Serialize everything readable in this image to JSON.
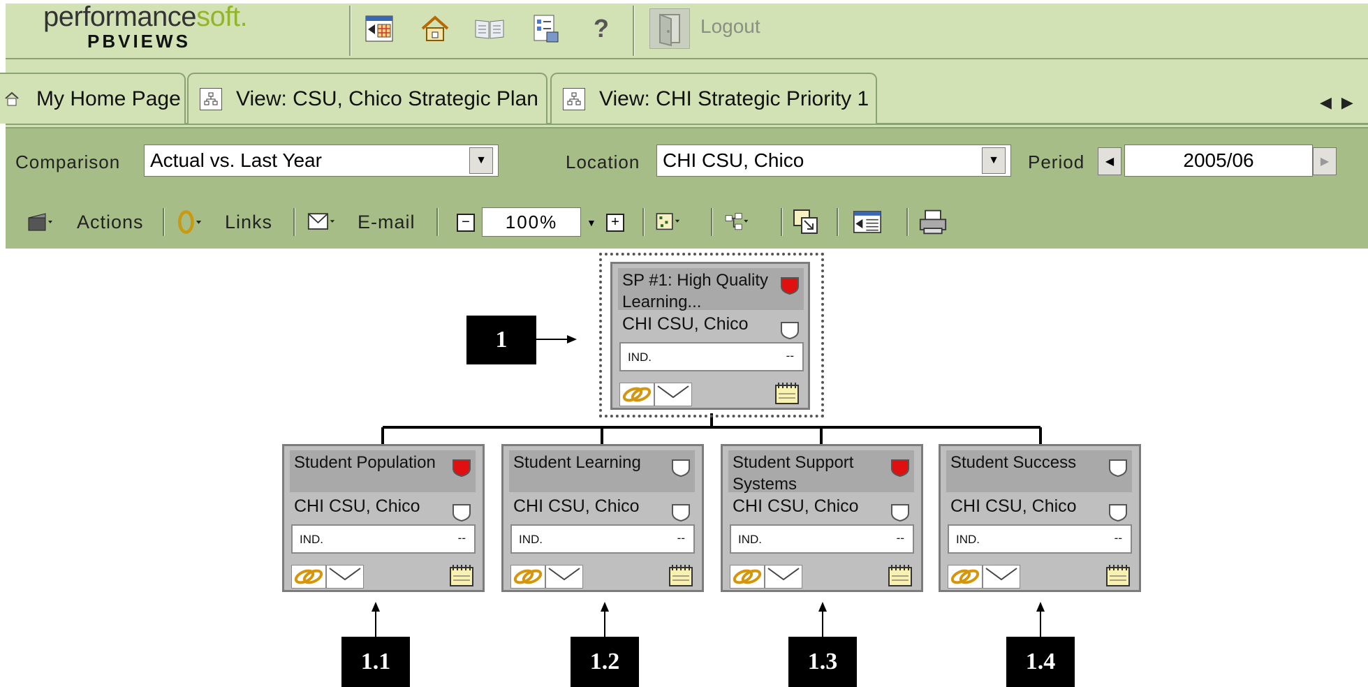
{
  "app": {
    "logo_main": "performance",
    "logo_accent": "soft.",
    "logo_sub": "PBVIEWS",
    "logout_label": "Logout",
    "help_label": "?"
  },
  "tabs": [
    {
      "label": "My Home Page",
      "icon": "home-icon"
    },
    {
      "label": "View: CSU, Chico Strategic Plan",
      "icon": "hierarchy-icon"
    },
    {
      "label": "View: CHI Strategic Priority 1",
      "icon": "hierarchy-icon"
    }
  ],
  "filters": {
    "comparison_label": "Comparison",
    "comparison_value": "Actual vs. Last Year",
    "location_label": "Location",
    "location_value": "CHI CSU, Chico",
    "period_label": "Period",
    "period_value": "2005/06"
  },
  "toolbar": {
    "actions_label": "Actions",
    "links_label": "Links",
    "email_label": "E-mail",
    "zoom_value": "100%"
  },
  "cards": [
    {
      "id": "1",
      "title": "SP #1: High Quality Learning...",
      "location": "CHI CSU, Chico",
      "indicator": "IND.",
      "value": "--",
      "status": "red"
    },
    {
      "id": "1.1",
      "title": "Student Population",
      "location": "CHI CSU, Chico",
      "indicator": "IND.",
      "value": "--",
      "status": "red"
    },
    {
      "id": "1.2",
      "title": "Student Learning",
      "location": "CHI CSU, Chico",
      "indicator": "IND.",
      "value": "--",
      "status": "none"
    },
    {
      "id": "1.3",
      "title": "Student Support Systems",
      "location": "CHI CSU, Chico",
      "indicator": "IND.",
      "value": "--",
      "status": "red"
    },
    {
      "id": "1.4",
      "title": "Student Success",
      "location": "CHI CSU, Chico",
      "indicator": "IND.",
      "value": "--",
      "status": "none"
    }
  ],
  "callouts": [
    "1",
    "1.1",
    "1.2",
    "1.3",
    "1.4"
  ],
  "colors": {
    "header_bg": "#d2e2b5",
    "toolbar_bg": "#a7bd87",
    "status_red": "#e01010",
    "card_bg": "#bfbfbf"
  }
}
